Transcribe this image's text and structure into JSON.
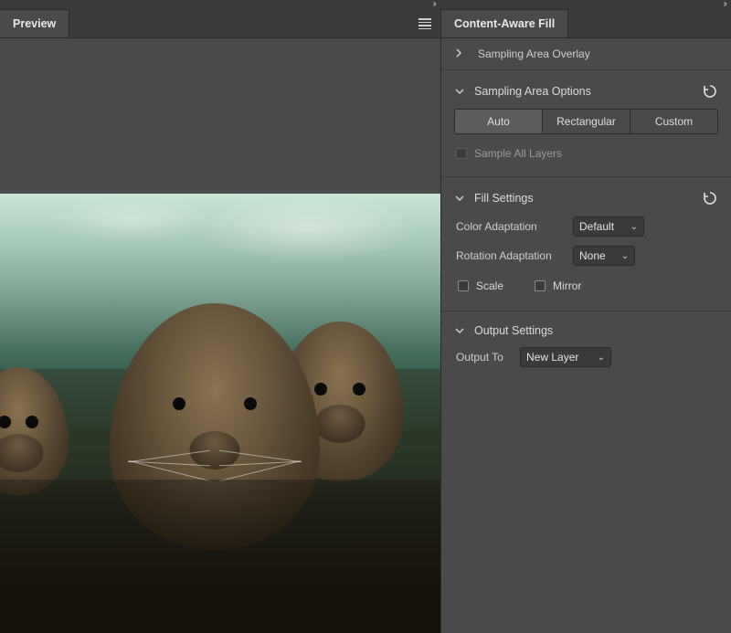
{
  "left": {
    "tab_title": "Preview"
  },
  "right": {
    "tab_title": "Content-Aware Fill",
    "sections": {
      "overlay": {
        "title": "Sampling Area Overlay",
        "expanded": false
      },
      "sampling": {
        "title": "Sampling Area Options",
        "expanded": true,
        "buttons": {
          "auto": "Auto",
          "rect": "Rectangular",
          "custom": "Custom",
          "active": "auto"
        },
        "sample_all_layers": {
          "label": "Sample All Layers",
          "enabled": false,
          "checked": false
        }
      },
      "fill": {
        "title": "Fill Settings",
        "expanded": true,
        "color_adaptation": {
          "label": "Color Adaptation",
          "value": "Default"
        },
        "rotation_adaptation": {
          "label": "Rotation Adaptation",
          "value": "None"
        },
        "scale": {
          "label": "Scale",
          "checked": false
        },
        "mirror": {
          "label": "Mirror",
          "checked": false
        }
      },
      "output": {
        "title": "Output Settings",
        "expanded": true,
        "output_to": {
          "label": "Output To",
          "value": "New Layer"
        }
      }
    }
  }
}
